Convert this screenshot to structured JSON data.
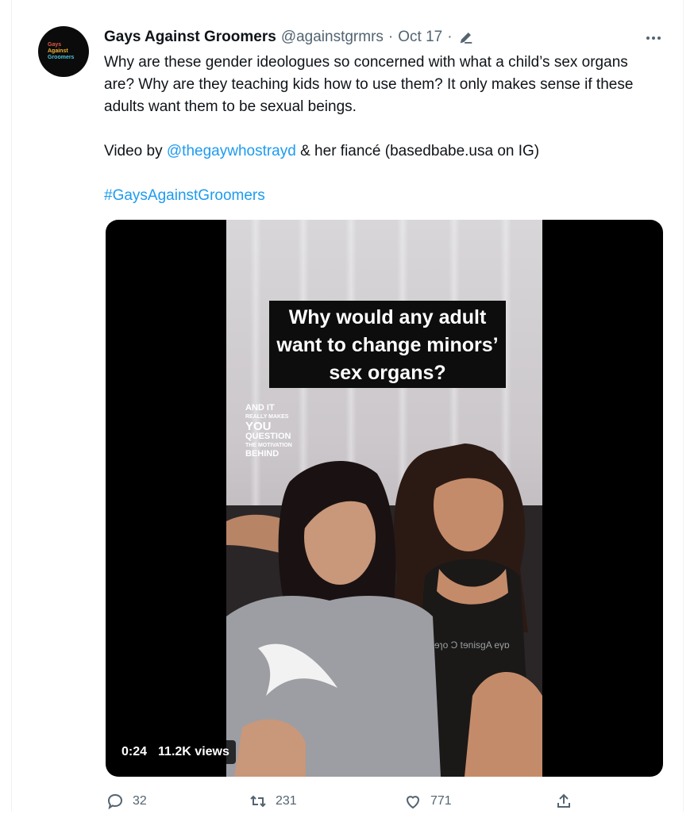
{
  "tweet": {
    "avatar_text": [
      "Gays",
      "Against",
      "Groomers"
    ],
    "display_name": "Gays Against Groomers",
    "handle": "@againstgrmrs",
    "separator": "·",
    "date": "Oct 17",
    "separator2": "·",
    "text_line1": "Why are these gender ideologues so concerned with what a child’s sex organs are? Why are they teaching kids how to use them? It only makes sense if these adults want them to be sexual beings.",
    "video_credit_prefix": "Video by ",
    "video_credit_mention": "@thegaywhostrayd",
    "video_credit_suffix": " & her fiancé (basedbabe.usa on IG)",
    "hashtag": "#GaysAgainstGroomers"
  },
  "video": {
    "caption": "Why would any adult want to change minors’ sex organs?",
    "overlay": {
      "line1": "AND IT",
      "line2": "REALLY MAKES",
      "line3": "YOU",
      "line4": "QUESTION",
      "line5": "THE MOTIVATION",
      "line6": "BEHIND"
    },
    "shirt_text": "ɘɿo Ͻ tɘnisgA eγɒ",
    "duration": "0:24",
    "views": "11.2K views"
  },
  "actions": {
    "replies": "32",
    "retweets": "231",
    "likes": "771"
  },
  "colors": {
    "link": "#1d9bf0",
    "muted": "#536471",
    "text": "#0f1419"
  },
  "icons": [
    "edit-icon",
    "more-icon",
    "reply-icon",
    "retweet-icon",
    "like-icon",
    "share-icon"
  ]
}
